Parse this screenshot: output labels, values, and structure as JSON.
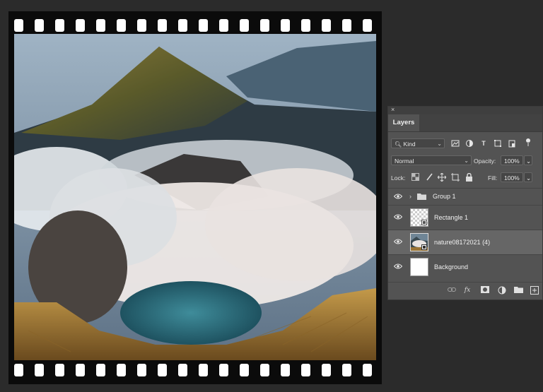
{
  "layers_panel": {
    "close_glyph": "×",
    "tab_label": "Layers",
    "filter_kind": "Kind",
    "blend_mode": "Normal",
    "opacity_label": "Opacity:",
    "opacity_value": "100%",
    "lock_label": "Lock:",
    "fill_label": "Fill:",
    "fill_value": "100%",
    "layers": [
      {
        "name": "Group 1",
        "type": "group",
        "selected": false
      },
      {
        "name": "Rectangle 1",
        "type": "shape",
        "selected": false
      },
      {
        "name": "nature08172021 (4)",
        "type": "image",
        "selected": true
      },
      {
        "name": "Background",
        "type": "background",
        "selected": false
      }
    ],
    "footer_icons": [
      "link-icon",
      "fx-icon",
      "mask-icon",
      "adjustment-icon",
      "folder-icon",
      "new-layer-icon"
    ],
    "fx_label": "fx"
  },
  "colors": {
    "panel_bg": "#535353",
    "selected_row": "#666666",
    "film": "#0b0b0b",
    "page_bg": "#2b2b2b"
  }
}
